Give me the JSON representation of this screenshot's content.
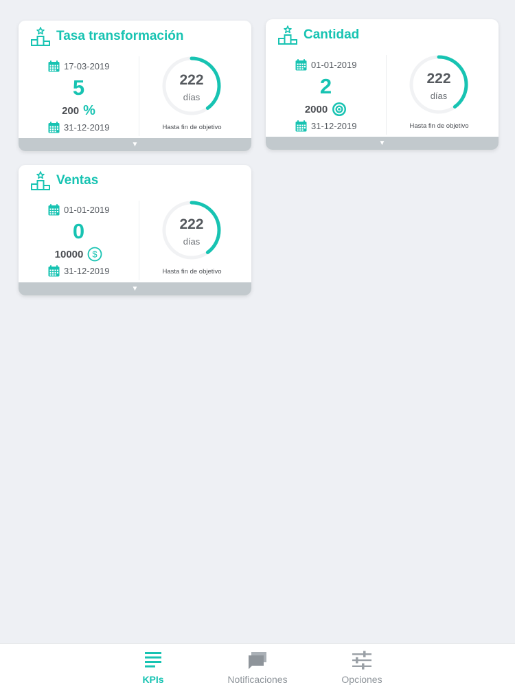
{
  "accent_color": "#17c3b2",
  "cards": [
    {
      "title": "Tasa transformación",
      "start_date": "17-03-2019",
      "value": "5",
      "target_value": "200",
      "target_unit_icon": "percent-icon",
      "target_unit_text": "%",
      "end_date": "31-12-2019",
      "days_remaining": "222",
      "days_label": "días",
      "progress_fraction": 0.4,
      "caption": "Hasta fin de objetivo"
    },
    {
      "title": "Cantidad",
      "start_date": "01-01-2019",
      "value": "2",
      "target_value": "2000",
      "target_unit_icon": "target-icon",
      "end_date": "31-12-2019",
      "days_remaining": "222",
      "days_label": "días",
      "progress_fraction": 0.4,
      "caption": "Hasta fin de objetivo"
    },
    {
      "title": "Ventas",
      "start_date": "01-01-2019",
      "value": "0",
      "target_value": "10000",
      "target_unit_icon": "dollar-icon",
      "end_date": "31-12-2019",
      "days_remaining": "222",
      "days_label": "días",
      "progress_fraction": 0.4,
      "caption": "Hasta fin de objetivo"
    }
  ],
  "tabbar": {
    "active": "KPIs",
    "items": [
      {
        "label": "KPIs",
        "icon": "list-icon"
      },
      {
        "label": "Notificaciones",
        "icon": "chat-icon"
      },
      {
        "label": "Opciones",
        "icon": "sliders-icon"
      }
    ]
  }
}
